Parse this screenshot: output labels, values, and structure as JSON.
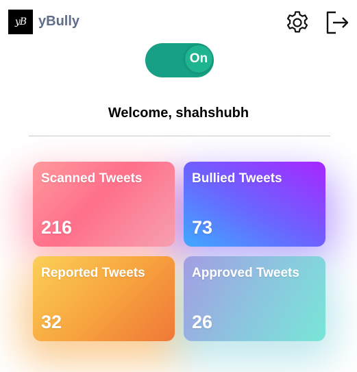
{
  "header": {
    "app_title": "yBully",
    "logo_text": "yB",
    "settings_icon": "gear-icon",
    "logout_icon": "logout-icon"
  },
  "toggle": {
    "label": "On",
    "state": "on",
    "color": "#17a085"
  },
  "welcome_text": "Welcome, shahshubh",
  "cards": [
    {
      "label": "Scanned Tweets",
      "value": "216"
    },
    {
      "label": "Bullied Tweets",
      "value": "73"
    },
    {
      "label": "Reported Tweets",
      "value": "32"
    },
    {
      "label": "Approved Tweets",
      "value": "26"
    }
  ]
}
